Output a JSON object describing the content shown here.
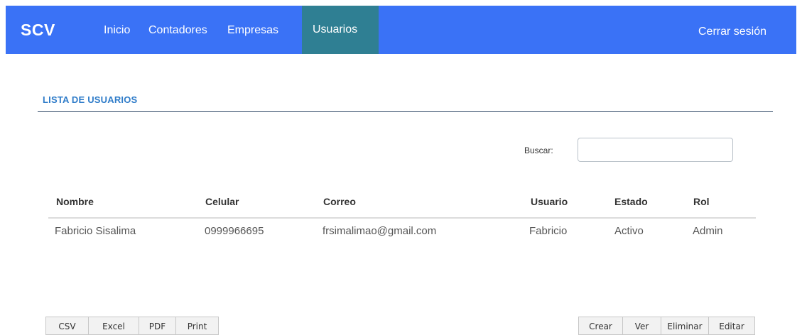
{
  "navbar": {
    "brand": "SCV",
    "links": [
      "Inicio",
      "Contadores",
      "Empresas",
      "Usuarios"
    ],
    "active_link": "Usuarios",
    "logout": "Cerrar sesión",
    "bg_color": "#3a72f6",
    "active_color": "#2f7f93"
  },
  "page": {
    "title": "LISTA DE USUARIOS"
  },
  "search": {
    "label": "Buscar:",
    "value": ""
  },
  "table": {
    "headers": [
      "Nombre",
      "Celular",
      "Correo",
      "Usuario",
      "Estado",
      "Rol"
    ],
    "rows": [
      [
        "Fabricio Sisalima",
        "0999966695",
        "frsimalimao@gmail.com",
        "Fabricio",
        "Activo",
        "Admin"
      ]
    ]
  },
  "export_buttons": [
    "CSV",
    "Excel",
    "PDF",
    "Print"
  ],
  "action_buttons": [
    "Crear",
    "Ver",
    "Eliminar",
    "Editar"
  ]
}
